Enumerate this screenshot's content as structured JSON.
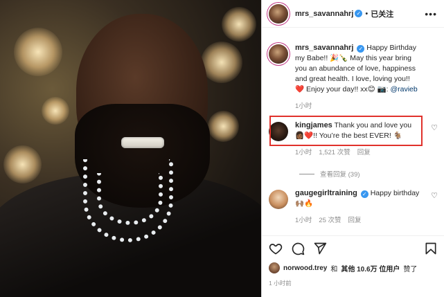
{
  "header": {
    "username": "mrs_savannahrj",
    "separator": "•",
    "follow_status": "已关注",
    "more": "•••"
  },
  "caption": {
    "username": "mrs_savannahrj",
    "text_part1": "Happy Birthday my Babe!! 🎉🍾 May this year bring you an abundance of love, happiness and great health. I love, loving you!! ❤️ Enjoy your day!! xx😊 📷:",
    "mention": "@ravieb",
    "time": "1小时"
  },
  "comments": [
    {
      "username": "kingjames",
      "text": "Thank you and love you 👩🏾❤️!! You’re the best EVER! 🐐",
      "time": "1小时",
      "likes": "1,521 次赞",
      "reply": "回复"
    },
    {
      "username": "gaugegirltraining",
      "text": "Happy birthday 🙌🏽🔥",
      "time": "1小时",
      "likes": "25 次赞",
      "reply": "回复"
    }
  ],
  "view_replies": "查看回复 (39)",
  "likes_line": {
    "user": "norwood.trey",
    "connector": "和",
    "others": "其他 10.6万 位用户",
    "suffix": "赞了"
  },
  "post_time": "1 小时前",
  "icons": [
    "more-icon",
    "verified-icon",
    "heart-icon",
    "comment-icon",
    "share-icon",
    "bookmark-icon"
  ],
  "colors": {
    "verified": "#3897f0",
    "highlight_border": "#e0312b",
    "muted": "#8e8e8e",
    "link": "#00376b"
  }
}
